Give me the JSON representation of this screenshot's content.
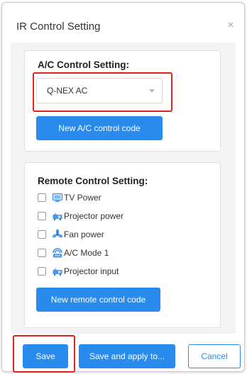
{
  "dialog": {
    "title": "IR Control Setting",
    "close_glyph": "×"
  },
  "ac_section": {
    "heading": "A/C Control Setting:",
    "select": {
      "selected_value": "Q-NEX AC"
    },
    "new_code_button": "New A/C control code"
  },
  "remote_section": {
    "heading": "Remote Control Setting:",
    "items": [
      {
        "label": "TV Power",
        "icon": "tv-icon",
        "checked": false
      },
      {
        "label": "Projector power",
        "icon": "projector-icon",
        "checked": false
      },
      {
        "label": "Fan power",
        "icon": "fan-icon",
        "checked": false
      },
      {
        "label": "A/C Mode 1",
        "icon": "air-conditioner-icon",
        "checked": false
      },
      {
        "label": "Projector input",
        "icon": "projector-icon",
        "checked": false
      }
    ],
    "new_code_button": "New remote control code"
  },
  "footer": {
    "save": "Save",
    "save_and_apply": "Save and apply to...",
    "cancel": "Cancel"
  },
  "colors": {
    "primary": "#2a8bef",
    "highlight": "#e2231a",
    "background_panel": "#f3f3f3"
  }
}
